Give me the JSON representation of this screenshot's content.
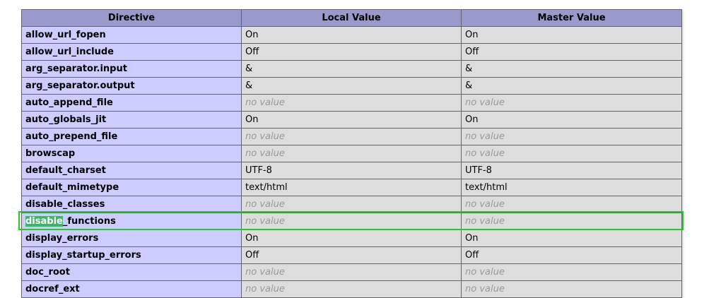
{
  "table": {
    "headers": [
      "Directive",
      "Local Value",
      "Master Value"
    ],
    "rows": [
      {
        "directive": "allow_url_fopen",
        "local": "On",
        "master": "On",
        "no_value": false
      },
      {
        "directive": "allow_url_include",
        "local": "Off",
        "master": "Off",
        "no_value": false
      },
      {
        "directive": "arg_separator.input",
        "local": "&",
        "master": "&",
        "no_value": false
      },
      {
        "directive": "arg_separator.output",
        "local": "&",
        "master": "&",
        "no_value": false
      },
      {
        "directive": "auto_append_file",
        "local": "no value",
        "master": "no value",
        "no_value": true
      },
      {
        "directive": "auto_globals_jit",
        "local": "On",
        "master": "On",
        "no_value": false
      },
      {
        "directive": "auto_prepend_file",
        "local": "no value",
        "master": "no value",
        "no_value": true
      },
      {
        "directive": "browscap",
        "local": "no value",
        "master": "no value",
        "no_value": true
      },
      {
        "directive": "default_charset",
        "local": "UTF-8",
        "master": "UTF-8",
        "no_value": false
      },
      {
        "directive": "default_mimetype",
        "local": "text/html",
        "master": "text/html",
        "no_value": false
      },
      {
        "directive": "disable_classes",
        "local": "no value",
        "master": "no value",
        "no_value": true
      },
      {
        "directive_selected": "disable",
        "directive_rest": "_functions",
        "local": "no value",
        "master": "no value",
        "no_value": true,
        "highlighted": true
      },
      {
        "directive": "display_errors",
        "local": "On",
        "master": "On",
        "no_value": false
      },
      {
        "directive": "display_startup_errors",
        "local": "Off",
        "master": "Off",
        "no_value": false
      },
      {
        "directive": "doc_root",
        "local": "no value",
        "master": "no value",
        "no_value": true
      },
      {
        "directive": "docref_ext",
        "local": "no value",
        "master": "no value",
        "no_value": true
      }
    ]
  },
  "colors": {
    "header_bg": "#9999cc",
    "directive_bg": "#ccccff",
    "value_bg": "#dddddd",
    "highlight_border": "#22cc22",
    "selection_bg": "#3fb36a"
  }
}
